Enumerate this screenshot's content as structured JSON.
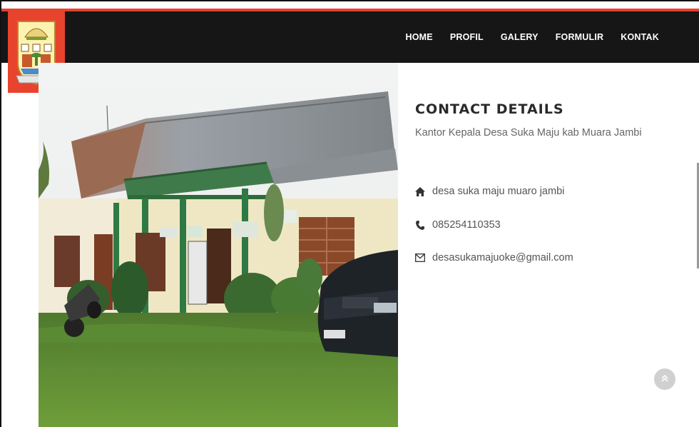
{
  "nav": {
    "items": [
      {
        "label": "HOME"
      },
      {
        "label": "PROFIL"
      },
      {
        "label": "GALERY"
      },
      {
        "label": "FORMULIR"
      },
      {
        "label": "KONTAK"
      }
    ]
  },
  "contact": {
    "title": "CONTACT DETAILS",
    "subtitle": "Kantor Kepala Desa Suka Maju kab Muara Jambi",
    "address": "desa suka maju muaro jambi",
    "phone": "085254110353",
    "email": "desasukamajuoke@gmail.com"
  },
  "icons": {
    "address": "home-icon",
    "phone": "phone-icon",
    "email": "envelope-icon",
    "back_to_top": "double-chevron-up-icon"
  },
  "colors": {
    "accent": "#e8432d",
    "navbar": "#161616"
  }
}
